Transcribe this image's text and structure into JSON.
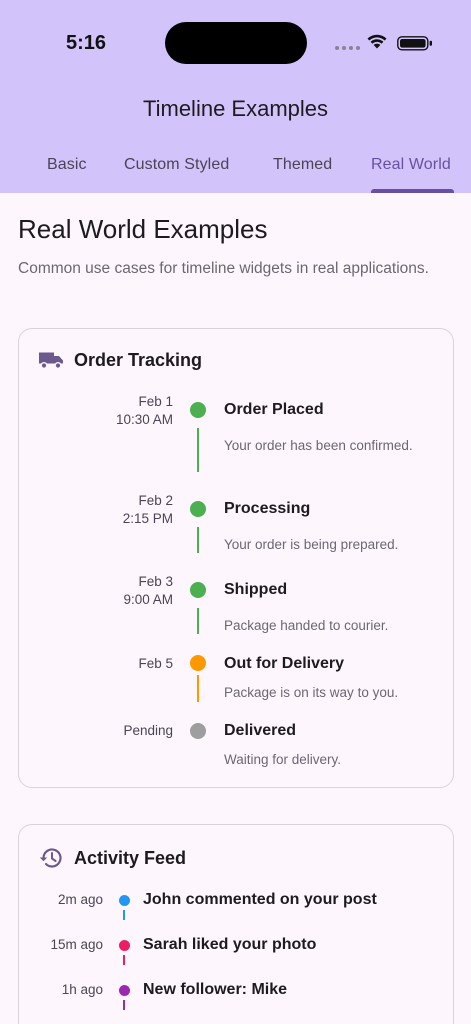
{
  "status_bar": {
    "time": "5:16"
  },
  "app_bar": {
    "title": "Timeline Examples"
  },
  "tabs": [
    {
      "label": "Basic"
    },
    {
      "label": "Custom Styled"
    },
    {
      "label": "Themed"
    },
    {
      "label": "Real World",
      "selected": true
    }
  ],
  "page": {
    "title": "Real World Examples",
    "description": "Common use cases for timeline widgets in real applications."
  },
  "order_tracking": {
    "title": "Order Tracking",
    "icon": "truck-icon",
    "events": [
      {
        "date": "Feb 1",
        "time": "10:30 AM",
        "title": "Order Placed",
        "subtitle": "Your order has been confirmed.",
        "color": "#4caf50"
      },
      {
        "date": "Feb 2",
        "time": "2:15 PM",
        "title": "Processing",
        "subtitle": "Your order is being prepared.",
        "color": "#4caf50"
      },
      {
        "date": "Feb 3",
        "time": "9:00 AM",
        "title": "Shipped",
        "subtitle": "Package handed to courier.",
        "color": "#4caf50"
      },
      {
        "date": "Feb 5",
        "time": "",
        "title": "Out for Delivery",
        "subtitle": "Package is on its way to you.",
        "color": "#ff9800"
      },
      {
        "date": "Pending",
        "time": "",
        "title": "Delivered",
        "subtitle": "Waiting for delivery.",
        "color": "#9e9e9e"
      }
    ]
  },
  "activity_feed": {
    "title": "Activity Feed",
    "icon": "history-icon",
    "items": [
      {
        "time": "2m ago",
        "text": "John commented on your post",
        "color": "#2196f3"
      },
      {
        "time": "15m ago",
        "text": "Sarah liked your photo",
        "color": "#e91e63"
      },
      {
        "time": "1h ago",
        "text": "New follower: Mike",
        "color": "#9c27b0"
      }
    ]
  }
}
